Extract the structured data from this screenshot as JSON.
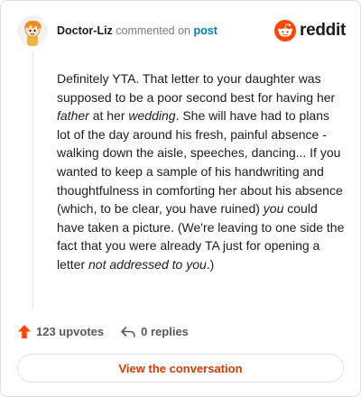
{
  "comment": {
    "author": "Doctor-Liz",
    "commented_on": "commented on",
    "post_link": "post",
    "body": {
      "s1": "Definitely YTA. That letter to your daughter was supposed to be a poor second best for having her ",
      "e1": "father",
      "s2": " at her ",
      "e2": "wedding",
      "s3": ". She will have had to plans lot of the day around his fresh, painful absence - walking down the aisle, speeches, dancing... If you wanted to keep a sample of his handwriting and thoughtfulness in comforting her about his absence (which, to be clear, you have ruined) ",
      "e3": "you",
      "s4": " could have taken a picture. (We're leaving to one side the fact that you were already TA just for opening a letter ",
      "e4": "not addressed to you",
      "s5": ".)"
    }
  },
  "brand": {
    "name": "reddit",
    "icon": "reddit-snoo-icon",
    "color": "#ff4500"
  },
  "actions": {
    "upvotes": "123 upvotes",
    "replies": "0 replies",
    "upvote_icon": "upvote-arrow-icon",
    "reply_icon": "reply-arrow-icon",
    "upvote_color": "#ff4500"
  },
  "cta": {
    "label": "View the conversation",
    "color": "#d93a00"
  }
}
